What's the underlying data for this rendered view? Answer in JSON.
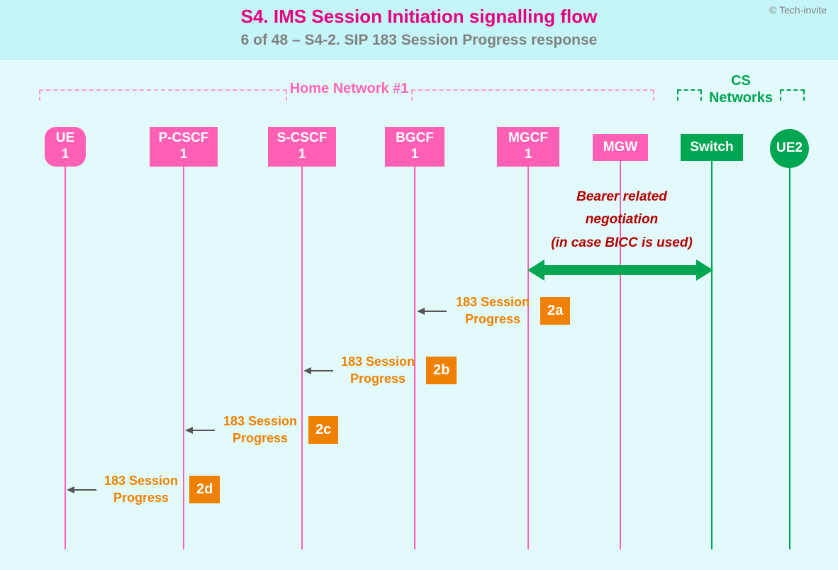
{
  "copyright": "© Tech-invite",
  "title": "S4. IMS Session Initiation signalling flow",
  "subtitle": "6 of 48 – S4-2. SIP 183 Session Progress response",
  "groups": {
    "home": "Home Network #1",
    "cs_line1": "CS",
    "cs_line2": "Networks"
  },
  "nodes": {
    "ue1_line1": "UE",
    "ue1_line2": "1",
    "pcscf_line1": "P-CSCF",
    "pcscf_line2": "1",
    "scscf_line1": "S-CSCF",
    "scscf_line2": "1",
    "bgcf_line1": "BGCF",
    "bgcf_line2": "1",
    "mgcf_line1": "MGCF",
    "mgcf_line2": "1",
    "mgw": "MGW",
    "switch": "Switch",
    "ue2": "UE2"
  },
  "bearer": {
    "line1": "Bearer related",
    "line2": "negotiation",
    "line3": "(in case BICC is used)"
  },
  "messages": {
    "step2a": {
      "id": "2a",
      "l1": "183 Session",
      "l2": "Progress"
    },
    "step2b": {
      "id": "2b",
      "l1": "183 Session",
      "l2": "Progress"
    },
    "step2c": {
      "id": "2c",
      "l1": "183 Session",
      "l2": "Progress"
    },
    "step2d": {
      "id": "2d",
      "l1": "183 Session",
      "l2": "Progress"
    }
  }
}
